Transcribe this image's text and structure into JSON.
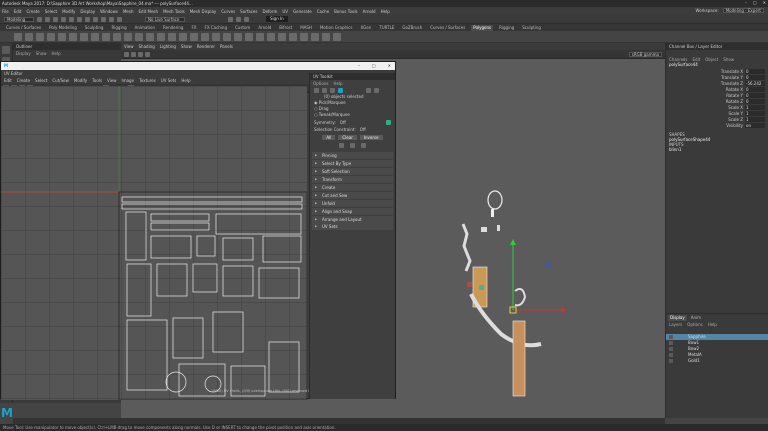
{
  "window": {
    "title": "Autodesk Maya 2017: D:\\Sapphire 3D Art Workshop\\Maya\\Sapphire_04.ma* --- polySurface44...",
    "controls": [
      "–",
      "□",
      "✕"
    ]
  },
  "menubar": {
    "items": [
      "File",
      "Edit",
      "Create",
      "Select",
      "Modify",
      "Display",
      "Windows",
      "Mesh",
      "Edit Mesh",
      "Mesh Tools",
      "Mesh Display",
      "Curves",
      "Surfaces",
      "Deform",
      "UV",
      "Generate",
      "Cache",
      "Bonus Tools",
      "Arnold",
      "Help"
    ],
    "workspace_label": "Workspace:",
    "workspace_value": "Modeling - Expert"
  },
  "statusline": {
    "mode": "Modeling",
    "live_surface": "No Live Surface",
    "sign_in": "Sign In"
  },
  "shelf_tabs": {
    "items": [
      "Curves / Surfaces",
      "Poly Modeling",
      "Sculpting",
      "Rigging",
      "Animation",
      "Rendering",
      "FX",
      "FX Caching",
      "Custom",
      "Arnold",
      "Bifrost",
      "MASH",
      "Motion Graphics",
      "XGen",
      "TURTLE",
      "GoZBrush",
      "Curves / Surfaces",
      "Polygons",
      "Rigging",
      "Sculpting"
    ],
    "active_index": 17
  },
  "outliner": {
    "title": "Outliner",
    "menu": [
      "Display",
      "Show",
      "Help"
    ]
  },
  "viewport": {
    "menu": [
      "View",
      "Shading",
      "Lighting",
      "Show",
      "Renderer",
      "Panels"
    ],
    "camera_value": "sRGB gamma"
  },
  "uv_editor": {
    "title": "UV Editor",
    "menu": [
      "Edit",
      "Create",
      "Select",
      "Cut/Sew",
      "Modify",
      "Tools",
      "View",
      "Image",
      "Textures",
      "UV Sets",
      "Help"
    ],
    "texture_label": "4096x4096 Texel Density",
    "field_1": "0.00",
    "field_2": "1.00",
    "colorspace": "sRGB gamma",
    "status_text": "(8/80) UV shells, (0/0) overlapping UVs, (0/0) reversed UVs"
  },
  "uv_toolkit": {
    "title": "UV Toolkit",
    "menu": [
      "Options",
      "Help"
    ],
    "selected_count": "(0) objects selected",
    "pick_options": [
      "Pick/Marquee",
      "Drag",
      "Tweak/Marquee"
    ],
    "symmetry_label": "Symmetry:",
    "symmetry_value": "Off",
    "constraint_label": "Selection Constraint:",
    "constraint_value": "Off",
    "buttons": [
      "All",
      "Clear",
      "Inverse"
    ],
    "sections": [
      "Pinning",
      "Select By Type",
      "Soft Selection",
      "Transform",
      "Create",
      "Cut and Sew",
      "Unfold",
      "Align and Snap",
      "Arrange and Layout"
    ],
    "footer": "UV Sets"
  },
  "channel_box": {
    "title": "Channel Box / Layer Editor",
    "menu": [
      "Channels",
      "Edit",
      "Object",
      "Show"
    ],
    "object_name": "polySurface44",
    "attributes": [
      {
        "name": "Translate X",
        "value": "0"
      },
      {
        "name": "Translate Y",
        "value": "0"
      },
      {
        "name": "Translate Z",
        "value": "-56.242"
      },
      {
        "name": "Rotate X",
        "value": "0"
      },
      {
        "name": "Rotate Y",
        "value": "0"
      },
      {
        "name": "Rotate Z",
        "value": "0"
      },
      {
        "name": "Scale X",
        "value": "1"
      },
      {
        "name": "Scale Y",
        "value": "1"
      },
      {
        "name": "Scale Z",
        "value": "1"
      },
      {
        "name": "Visibility",
        "value": "on"
      }
    ],
    "shapes_label": "SHAPES",
    "shape_name": "polySurfaceShape44",
    "inputs_label": "INPUTS",
    "input_name": "blinn1"
  },
  "layer_editor": {
    "tabs": [
      "Display",
      "Anim"
    ],
    "menu": [
      "Layers",
      "Options",
      "Help"
    ],
    "layers": [
      {
        "name": "Sapphire",
        "selected": true
      },
      {
        "name": "Bow1",
        "selected": false
      },
      {
        "name": "Bow2",
        "selected": false
      },
      {
        "name": "MetalA",
        "selected": false
      },
      {
        "name": "Gold1",
        "selected": false
      }
    ]
  },
  "helpline": {
    "text": "Move Tool: Use manipulator to move object(s). Ctrl+LMB-drag to move components along normals. Use D or INSERT to change the pivot position and axis orientation."
  },
  "logo": {
    "letter": "M"
  },
  "colors": {
    "maya_blue": "#1fa0c8",
    "selection": "#5285a6",
    "axis_x": "#cc3333",
    "axis_y": "#33cc33",
    "axis_z": "#3355cc"
  }
}
